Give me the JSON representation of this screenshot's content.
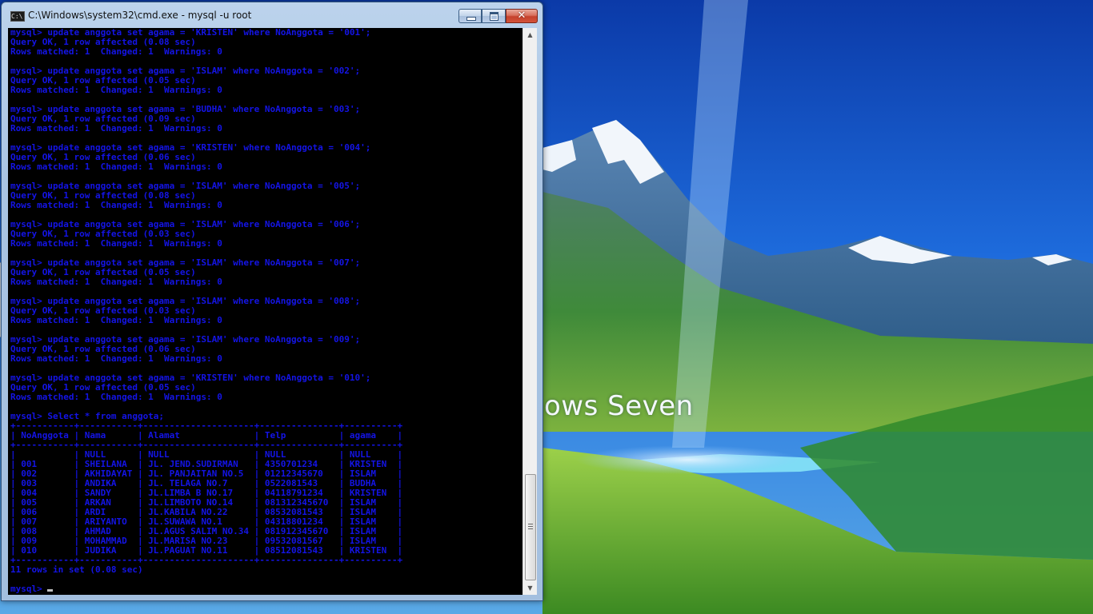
{
  "window": {
    "title": "C:\\Windows\\system32\\cmd.exe - mysql  -u root",
    "icon_text": "C:\\",
    "buttons": {
      "close": "✕"
    }
  },
  "console": {
    "text_color": "#1414e6",
    "lines": [
      "mysql> update anggota set agama = 'KRISTEN' where NoAnggota = '001';",
      "Query OK, 1 row affected (0.08 sec)",
      "Rows matched: 1  Changed: 1  Warnings: 0",
      "",
      "mysql> update anggota set agama = 'ISLAM' where NoAnggota = '002';",
      "Query OK, 1 row affected (0.05 sec)",
      "Rows matched: 1  Changed: 1  Warnings: 0",
      "",
      "mysql> update anggota set agama = 'BUDHA' where NoAnggota = '003';",
      "Query OK, 1 row affected (0.09 sec)",
      "Rows matched: 1  Changed: 1  Warnings: 0",
      "",
      "mysql> update anggota set agama = 'KRISTEN' where NoAnggota = '004';",
      "Query OK, 1 row affected (0.06 sec)",
      "Rows matched: 1  Changed: 1  Warnings: 0",
      "",
      "mysql> update anggota set agama = 'ISLAM' where NoAnggota = '005';",
      "Query OK, 1 row affected (0.08 sec)",
      "Rows matched: 1  Changed: 1  Warnings: 0",
      "",
      "mysql> update anggota set agama = 'ISLAM' where NoAnggota = '006';",
      "Query OK, 1 row affected (0.03 sec)",
      "Rows matched: 1  Changed: 1  Warnings: 0",
      "",
      "mysql> update anggota set agama = 'ISLAM' where NoAnggota = '007';",
      "Query OK, 1 row affected (0.05 sec)",
      "Rows matched: 1  Changed: 1  Warnings: 0",
      "",
      "mysql> update anggota set agama = 'ISLAM' where NoAnggota = '008';",
      "Query OK, 1 row affected (0.03 sec)",
      "Rows matched: 1  Changed: 1  Warnings: 0",
      "",
      "mysql> update anggota set agama = 'ISLAM' where NoAnggota = '009';",
      "Query OK, 1 row affected (0.06 sec)",
      "Rows matched: 1  Changed: 1  Warnings: 0",
      "",
      "mysql> update anggota set agama = 'KRISTEN' where NoAnggota = '010';",
      "Query OK, 1 row affected (0.05 sec)",
      "Rows matched: 1  Changed: 1  Warnings: 0",
      "",
      "mysql> Select * from anggota;",
      "+-----------+-----------+---------------------+---------------+----------+",
      "| NoAnggota | Nama      | Alamat              | Telp          | agama    |",
      "+-----------+-----------+---------------------+---------------+----------+",
      "|           | NULL      | NULL                | NULL          | NULL     |",
      "| 001       | SHEILANA  | JL. JEND.SUDIRMAN   | 4350701234    | KRISTEN  |",
      "| 002       | AKHIDAYAT | JL. PANJAITAN NO.5  | 01212345670   | ISLAM    |",
      "| 003       | ANDIKA    | JL. TELAGA NO.7     | 0522081543    | BUDHA    |",
      "| 004       | SANDY     | JL.LIMBA B NO.17    | 04118791234   | KRISTEN  |",
      "| 005       | ARKAN     | JL.LIMBOTO NO.14    | 081312345670  | ISLAM    |",
      "| 006       | ARDI      | JL.KABILA NO.22     | 08532081543   | ISLAM    |",
      "| 007       | ARIYANTO  | JL.SUWAWA NO.1      | 04318801234   | ISLAM    |",
      "| 008       | AHMAD     | JL.AGUS SALIM NO.34 | 081912345670  | ISLAM    |",
      "| 009       | MOHAMMAD  | JL.MARISA NO.23     | 09532081567   | ISLAM    |",
      "| 010       | JUDIKA    | JL.PAGUAT NO.11     | 08512081543   | KRISTEN  |",
      "+-----------+-----------+---------------------+---------------+----------+",
      "11 rows in set (0.08 sec)",
      "",
      "mysql> "
    ]
  },
  "scrollbar": {
    "position_fraction": 0.86
  },
  "desktop": {
    "wallpaper_text": "ows Seven",
    "sky_color": "#1560d8",
    "grass_color": "#3e8a2c"
  }
}
